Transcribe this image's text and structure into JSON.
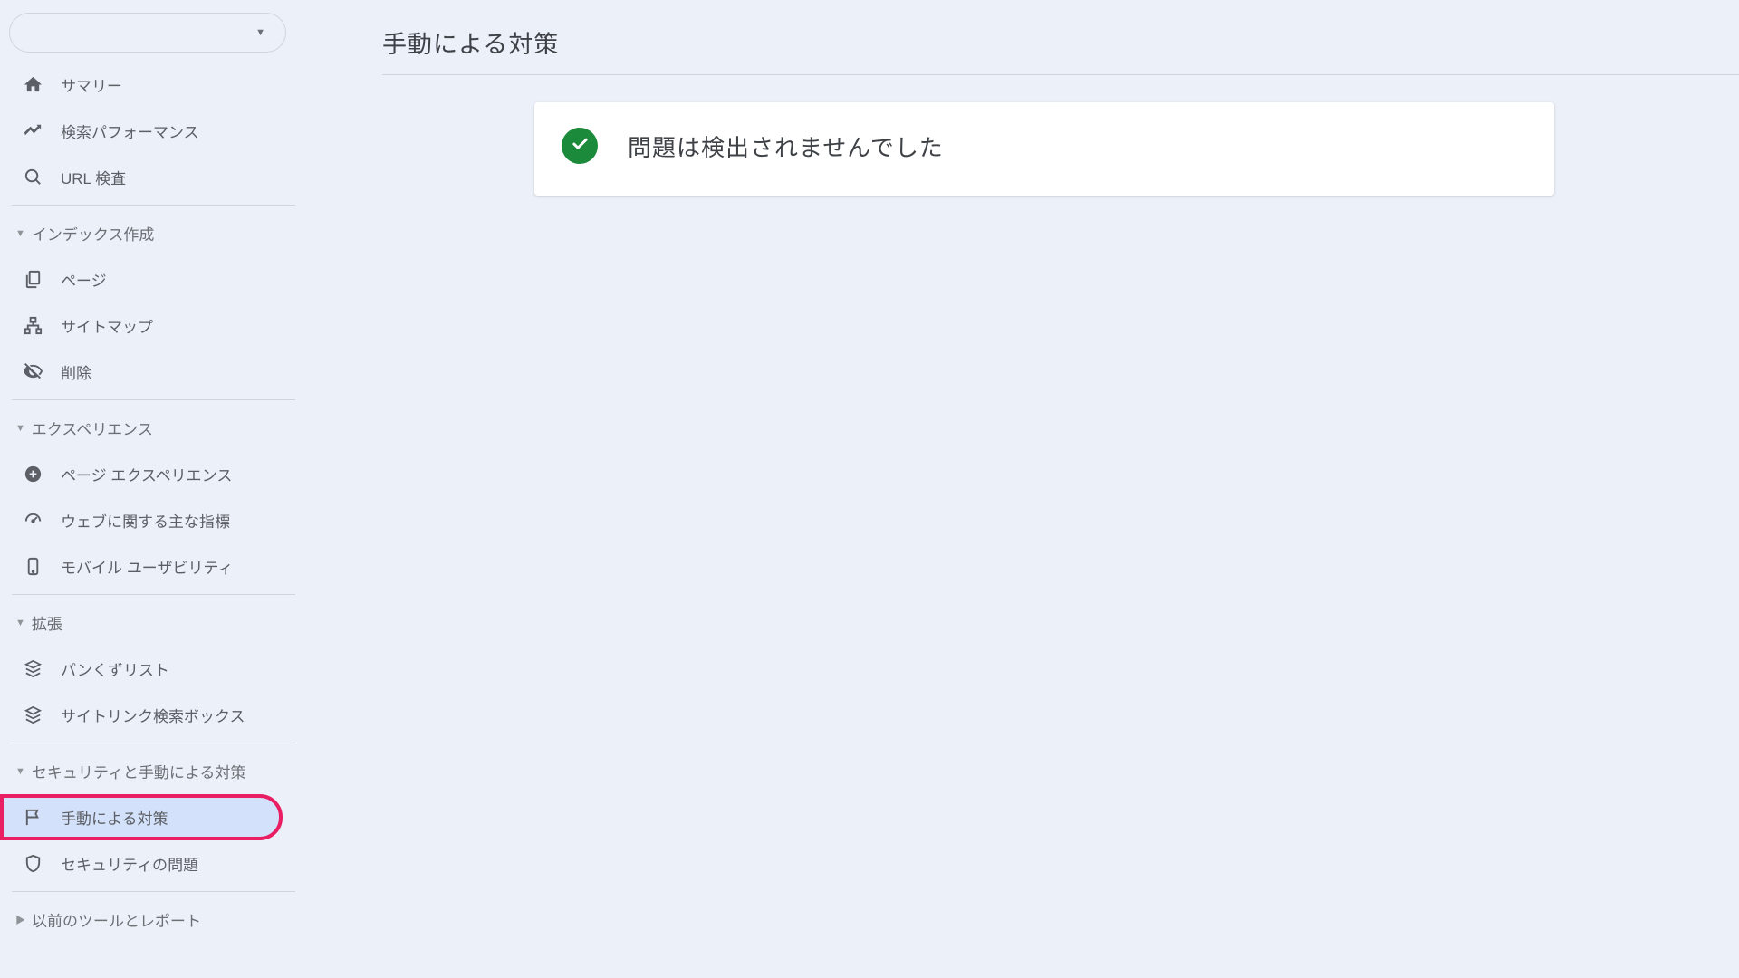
{
  "page": {
    "title": "手動による対策"
  },
  "status": {
    "message": "問題は検出されませんでした"
  },
  "sidebar": {
    "topItems": [
      {
        "label": "サマリー",
        "icon": "home"
      },
      {
        "label": "検索パフォーマンス",
        "icon": "trending"
      },
      {
        "label": "URL 検査",
        "icon": "search"
      }
    ],
    "sections": [
      {
        "title": "インデックス作成",
        "items": [
          {
            "label": "ページ",
            "icon": "pages"
          },
          {
            "label": "サイトマップ",
            "icon": "sitemap"
          },
          {
            "label": "削除",
            "icon": "hidden"
          }
        ]
      },
      {
        "title": "エクスペリエンス",
        "items": [
          {
            "label": "ページ エクスペリエンス",
            "icon": "plus-circle"
          },
          {
            "label": "ウェブに関する主な指標",
            "icon": "speed"
          },
          {
            "label": "モバイル ユーザビリティ",
            "icon": "mobile"
          }
        ]
      },
      {
        "title": "拡張",
        "items": [
          {
            "label": "パンくずリスト",
            "icon": "layers"
          },
          {
            "label": "サイトリンク検索ボックス",
            "icon": "layers"
          }
        ]
      },
      {
        "title": "セキュリティと手動による対策",
        "items": [
          {
            "label": "手動による対策",
            "icon": "flag",
            "active": true,
            "highlighted": true
          },
          {
            "label": "セキュリティの問題",
            "icon": "shield"
          }
        ]
      }
    ],
    "bottomSection": {
      "title": "以前のツールとレポート"
    }
  }
}
